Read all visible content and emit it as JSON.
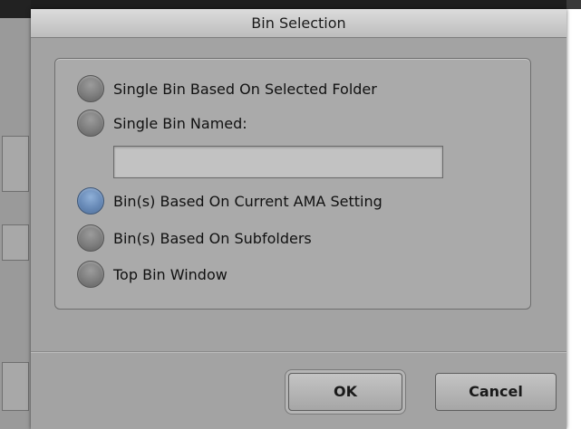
{
  "dialog": {
    "title": "Bin Selection",
    "options": [
      {
        "label": "Single Bin Based On Selected Folder",
        "selected": false
      },
      {
        "label": "Single Bin Named:",
        "selected": false
      },
      {
        "label": "Bin(s) Based On Current AMA Setting",
        "selected": true
      },
      {
        "label": "Bin(s) Based On Subfolders",
        "selected": false
      },
      {
        "label": "Top Bin Window",
        "selected": false
      }
    ],
    "bin_name_field": {
      "value": "",
      "placeholder": ""
    },
    "ok_label": "OK",
    "cancel_label": "Cancel"
  },
  "colors": {
    "dialog_bg": "#a3a3a3",
    "selected_radio": "#6789b6"
  }
}
